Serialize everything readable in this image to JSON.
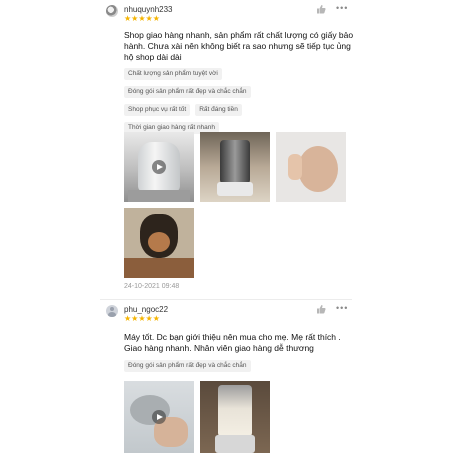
{
  "reviews": [
    {
      "username": "nhuquynh233",
      "rating": 5,
      "text": "Shop giao hàng nhanh, sản phẩm rất chất lượng có giấy bảo hành. Chưa xài nên không biết ra sao nhưng sẽ tiếp tục ủng hộ shop dài dài",
      "tags": [
        "Chất lượng sản phẩm tuyệt vời",
        "Đóng gói sản phẩm rất đẹp và chắc chắn",
        "Shop phục vụ rất tốt",
        "Rất đáng tiền",
        "Thời gian giao hàng rất nhanh"
      ],
      "date": "24-10-2021 09:48"
    },
    {
      "username": "phu_ngoc22",
      "rating": 5,
      "text": "Máy tốt. Dc bạn giới thiệu nên mua cho mẹ. Mẹ rất thích . Giao hàng nhanh. Nhân viên giao hàng dễ thương",
      "tags": [
        "Đóng gói sản phẩm rất đẹp và chắc chắn"
      ]
    }
  ],
  "icons": {
    "like": "thumbs-up-icon",
    "more": "more-options-icon",
    "star": "star-icon",
    "play": "play-icon"
  },
  "colors": {
    "star": "#f5b400",
    "tag_bg": "#f1f1f1",
    "date": "#999999"
  }
}
